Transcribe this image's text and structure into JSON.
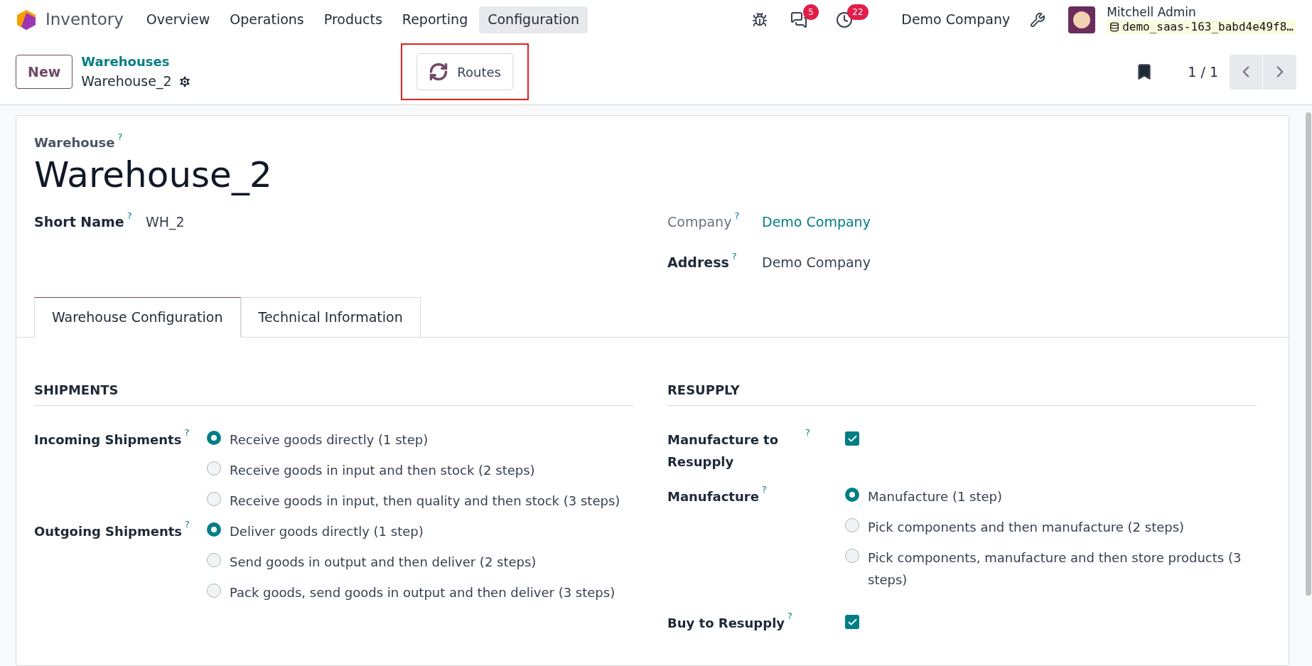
{
  "navbar": {
    "app_name": "Inventory",
    "menu": [
      {
        "label": "Overview",
        "selected": false
      },
      {
        "label": "Operations",
        "selected": false
      },
      {
        "label": "Products",
        "selected": false
      },
      {
        "label": "Reporting",
        "selected": false
      },
      {
        "label": "Configuration",
        "selected": true
      }
    ],
    "messages_count": "5",
    "activities_count": "22",
    "company": "Demo Company",
    "user": {
      "name": "Mitchell Admin",
      "database": "demo_saas-163_babd4e49f8…"
    }
  },
  "control_panel": {
    "new_button": "New",
    "breadcrumb": "Warehouses",
    "record": "Warehouse_2",
    "routes_button": "Routes",
    "pager": "1 / 1"
  },
  "form": {
    "name_label": "Warehouse",
    "name_help": "?",
    "name": "Warehouse_2",
    "left_fields": [
      {
        "label": "Short Name",
        "help": "?",
        "value": "WH_2"
      }
    ],
    "right_fields": [
      {
        "label": "Company",
        "help": "?",
        "value": "Demo Company",
        "kind": "link"
      },
      {
        "label": "Address",
        "help": "?",
        "value": "Demo Company",
        "kind": "text"
      }
    ],
    "tabs": [
      {
        "label": "Warehouse Configuration",
        "selected": true
      },
      {
        "label": "Technical Information",
        "selected": false
      }
    ],
    "shipments": {
      "title": "SHIPMENTS",
      "groups": [
        {
          "label": "Incoming Shipments",
          "help": "?",
          "options": [
            {
              "label": "Receive goods directly (1 step)",
              "selected": true
            },
            {
              "label": "Receive goods in input and then stock (2 steps)",
              "selected": false
            },
            {
              "label": "Receive goods in input, then quality and then stock (3 steps)",
              "selected": false
            }
          ]
        },
        {
          "label": "Outgoing Shipments",
          "help": "?",
          "options": [
            {
              "label": "Deliver goods directly (1 step)",
              "selected": true
            },
            {
              "label": "Send goods in output and then deliver (2 steps)",
              "selected": false
            },
            {
              "label": "Pack goods, send goods in output and then deliver (3 steps)",
              "selected": false
            }
          ]
        }
      ]
    },
    "resupply": {
      "title": "RESUPPLY",
      "groups": [
        {
          "kind": "checkbox",
          "label": "Manufacture to Resupply",
          "help": "?",
          "checked": true
        },
        {
          "kind": "radio",
          "label": "Manufacture",
          "help": "?",
          "options": [
            {
              "label": "Manufacture (1 step)",
              "selected": true
            },
            {
              "label": "Pick components and then manufacture (2 steps)",
              "selected": false
            },
            {
              "label": "Pick components, manufacture and then store products (3 steps)",
              "selected": false
            }
          ]
        },
        {
          "kind": "checkbox",
          "label": "Buy to Resupply",
          "help": "?",
          "checked": true
        }
      ]
    }
  }
}
